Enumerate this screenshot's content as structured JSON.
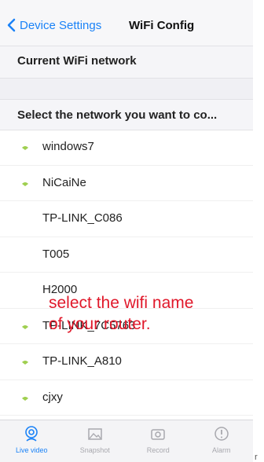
{
  "navbar": {
    "back_label": "Device Settings",
    "title": "WiFi Config",
    "accent": "#1a82f7"
  },
  "sections": {
    "current": "Current WiFi network",
    "select": "Select the network you want to co..."
  },
  "networks": [
    {
      "name": "windows7",
      "icon": "wifi-dot-icon"
    },
    {
      "name": "NiCaiNe",
      "icon": "wifi-dot-icon"
    },
    {
      "name": "TP-LINK_C086",
      "icon": ""
    },
    {
      "name": "T005",
      "icon": ""
    },
    {
      "name": "H2000",
      "icon": ""
    },
    {
      "name": "TP-LINK_7C5763",
      "icon": "wifi-dot-icon"
    },
    {
      "name": "TP-LINK_A810",
      "icon": "wifi-dot-icon"
    },
    {
      "name": "cjxy",
      "icon": "wifi-dot-icon"
    }
  ],
  "annotation": {
    "line1": "select the wifi name",
    "line2": "of your router.",
    "color": "#e0182a"
  },
  "tabs": [
    {
      "label": "Live video",
      "icon": "live-video-icon",
      "active": true
    },
    {
      "label": "Snapshot",
      "icon": "snapshot-icon",
      "active": false
    },
    {
      "label": "Record",
      "icon": "record-icon",
      "active": false
    },
    {
      "label": "Alarm",
      "icon": "alarm-icon",
      "active": false
    }
  ],
  "edge_char": "r"
}
